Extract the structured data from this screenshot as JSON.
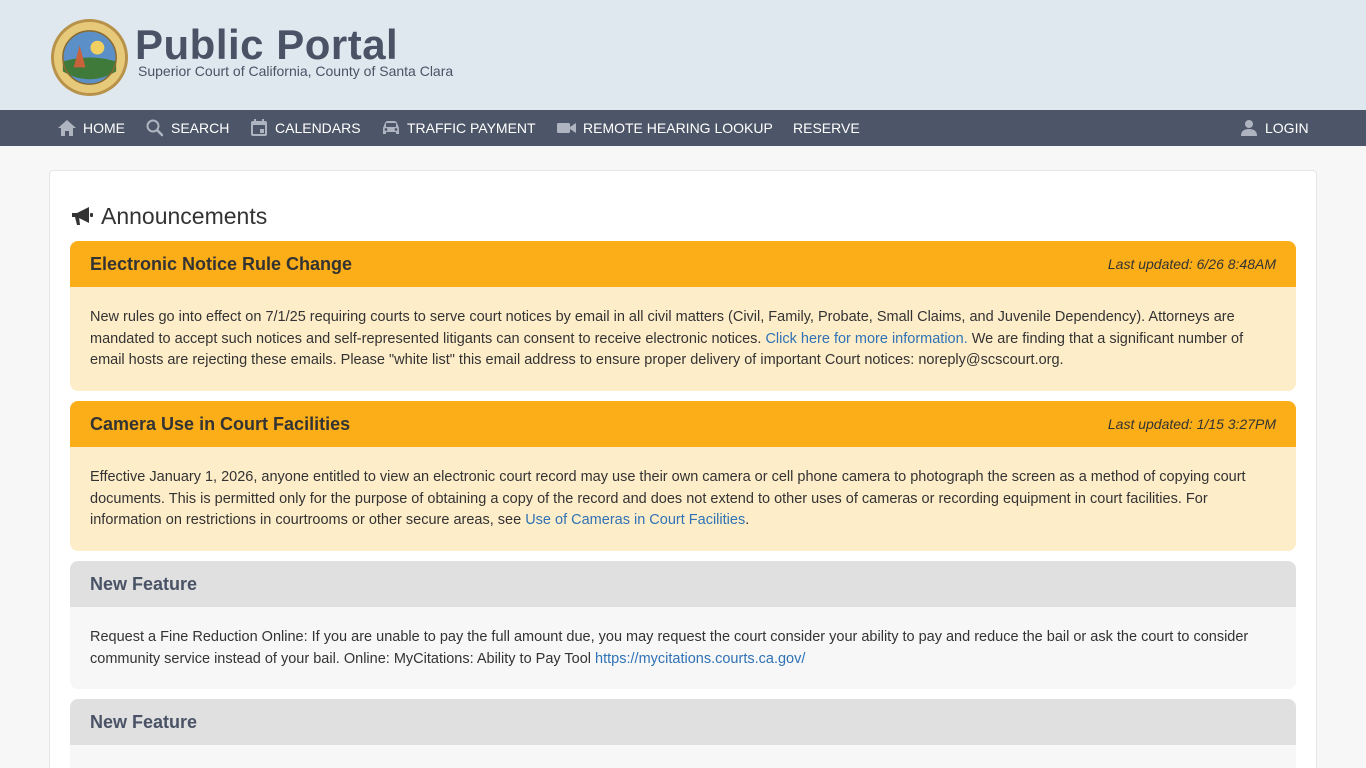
{
  "header": {
    "title": "Public Portal",
    "subtitle": "Superior Court of California, County of Santa Clara"
  },
  "nav": {
    "items": [
      {
        "label": "HOME",
        "icon": "home-icon"
      },
      {
        "label": "SEARCH",
        "icon": "search-icon"
      },
      {
        "label": "CALENDARS",
        "icon": "calendar-icon"
      },
      {
        "label": "TRAFFIC PAYMENT",
        "icon": "car-icon"
      },
      {
        "label": "REMOTE HEARING LOOKUP",
        "icon": "video-camera-icon"
      },
      {
        "label": "RESERVE",
        "icon": ""
      }
    ],
    "login": {
      "label": "LOGIN",
      "icon": "user-icon"
    }
  },
  "announcements": {
    "heading": "Announcements",
    "icon": "megaphone-icon",
    "cards": [
      {
        "title": "Electronic Notice Rule Change",
        "updated": "Last updated: 6/26 8:48AM",
        "body_before": "New rules go into effect on 7/1/25 requiring courts to serve court notices by email in all civil matters (Civil, Family, Probate, Small Claims, and Juvenile Dependency). Attorneys are mandated to accept such notices and self-represented litigants can consent to receive electronic notices. ",
        "link": "Click here for more information.",
        "body_after": " We are finding that a significant number of email hosts are rejecting these emails. Please \"white list\" this email address to ensure proper delivery of important Court notices: noreply@scscourt.org."
      },
      {
        "title": "Camera Use in Court Facilities",
        "updated": "Last updated: 1/15 3:27PM",
        "body_before": "Effective January 1, 2026, anyone entitled to view an electronic court record may use their own camera or cell phone camera to photograph the screen as a method of copying court documents. This is permitted only for the purpose of obtaining a copy of the record and does not extend to other uses of cameras or recording equipment in court facilities. For information on restrictions in courtrooms or other secure areas, see ",
        "link": "Use of Cameras in Court Facilities",
        "body_after": "."
      },
      {
        "title": "New Feature",
        "body_before": "Request a Fine Reduction Online: If you are unable to pay the full amount due, you may request the court consider your ability to pay and reduce the bail or ask the court to consider community service instead of your bail. Online: MyCitations: Ability to Pay Tool ",
        "link": "https://mycitations.courts.ca.gov/",
        "body_after": ""
      },
      {
        "title": "New Feature"
      }
    ]
  },
  "colors": {
    "nav_bg": "#4d5668",
    "header_bg": "#dfe8ee",
    "alert_header": "#fbae17",
    "alert_body": "#feedc9",
    "link": "#2f72b5"
  }
}
